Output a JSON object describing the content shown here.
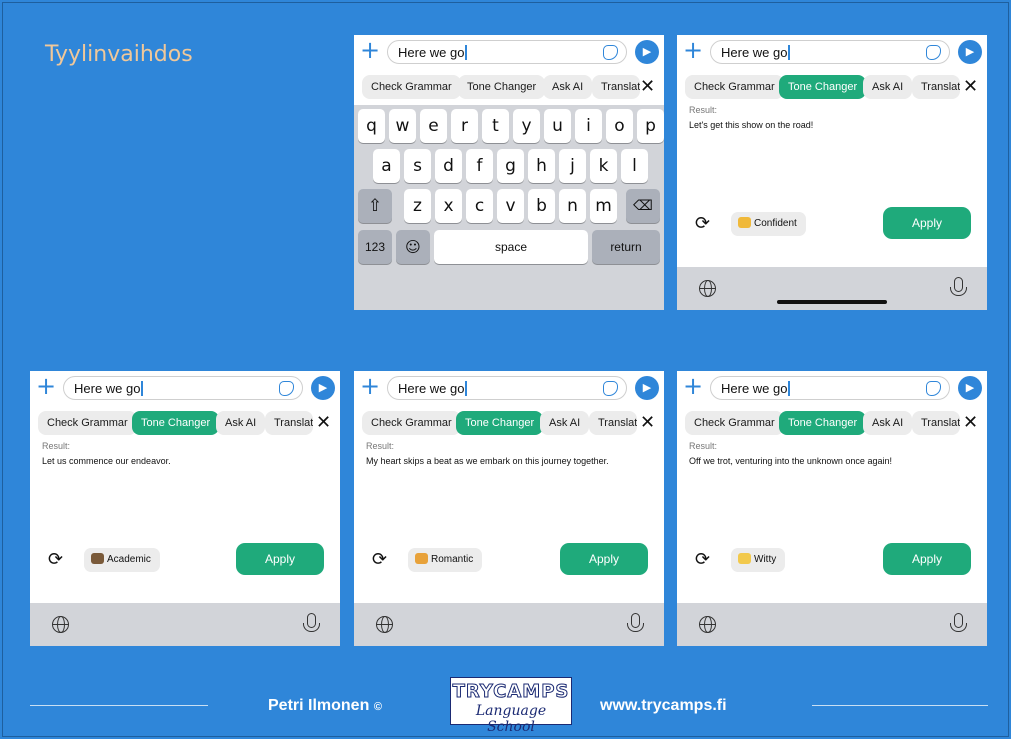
{
  "slide_title": "Tyylinvaihdos",
  "input_text": "Here we go",
  "chips": [
    "Check Grammar",
    "Tone Changer",
    "Ask AI",
    "Translat"
  ],
  "result_label": "Result:",
  "apply_label": "Apply",
  "panels": [
    {
      "result": "Let's get this show on the road!",
      "tone": "Confident",
      "tone_color": "#f0b93a"
    },
    {
      "result": "Let us commence our endeavor.",
      "tone": "Academic",
      "tone_color": "#7a5a3a"
    },
    {
      "result": "My heart skips a beat as we embark on this journey together.",
      "tone": "Romantic",
      "tone_color": "#e8a23a"
    },
    {
      "result": "Off we trot, venturing into the unknown once again!",
      "tone": "Witty",
      "tone_color": "#f2c94c"
    }
  ],
  "keyboard": {
    "row1": [
      "q",
      "w",
      "e",
      "r",
      "t",
      "y",
      "u",
      "i",
      "o",
      "p"
    ],
    "row2": [
      "a",
      "s",
      "d",
      "f",
      "g",
      "h",
      "j",
      "k",
      "l"
    ],
    "row3": [
      "z",
      "x",
      "c",
      "v",
      "b",
      "n",
      "m"
    ],
    "numbers": "123",
    "space": "space",
    "return": "return"
  },
  "footer": {
    "author": "Petri Ilmonen",
    "copyright": "©",
    "logo_top": "TRYCAMPS",
    "logo_bottom": "Language School",
    "url": "www.trycamps.fi"
  },
  "colors": {
    "background": "#2f86d9",
    "accent_green": "#1faa7b",
    "accent_blue": "#2f86d9"
  }
}
